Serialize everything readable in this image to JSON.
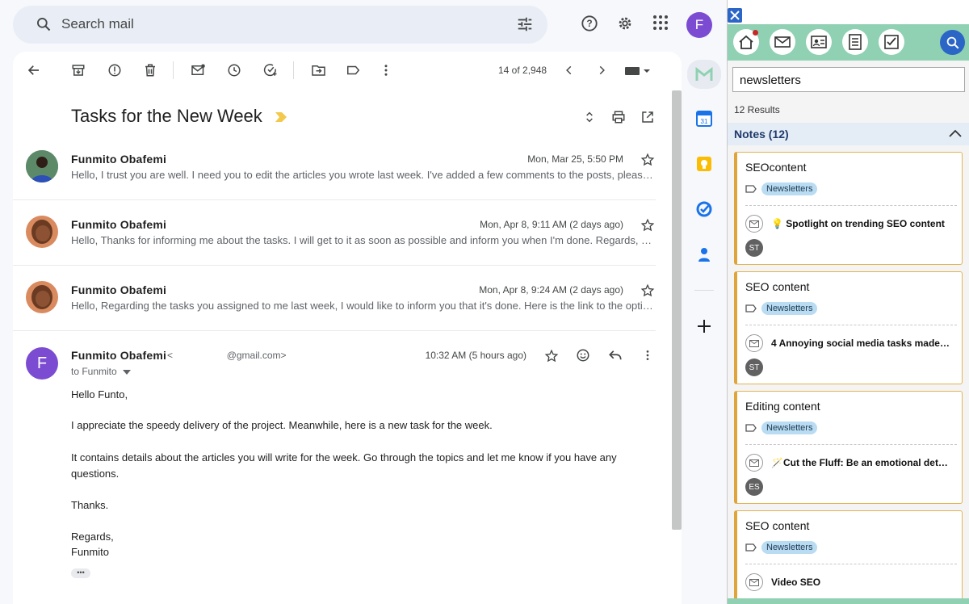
{
  "search": {
    "placeholder": "Search mail"
  },
  "account": {
    "initial": "F"
  },
  "toolbar": {
    "pager": "14 of 2,948"
  },
  "thread": {
    "subject": "Tasks for the New Week",
    "messages": [
      {
        "sender": "Funmito Obafemi",
        "date": "Mon, Mar 25, 5:50 PM",
        "snippet": "Hello, I trust you are well. I need you to edit the articles you wrote last week. I've added a few comments to the posts, please…"
      },
      {
        "sender": "Funmito Obafemi",
        "date": "Mon, Apr 8, 9:11 AM (2 days ago)",
        "snippet": "Hello, Thanks for informing me about the tasks. I will get to it as soon as possible and inform you when I'm done. Regards, …"
      },
      {
        "sender": "Funmito Obafemi",
        "date": "Mon, Apr 8, 9:24 AM (2 days ago)",
        "snippet": "Hello, Regarding the tasks you assigned to me last week, I would like to inform you that it's done. Here is the link to the opti…"
      }
    ],
    "open_message": {
      "sender": "Funmito Obafemi",
      "email": "<                    @gmail.com>",
      "date": "10:32 AM (5 hours ago)",
      "to": "to Funmito",
      "avatar_initial": "F",
      "body": [
        "Hello Funto,",
        "I appreciate the speedy delivery of the project. Meanwhile, here is a new task for the week.",
        "It contains details about the articles you will write for the week. Go through the topics and let me know if you have any",
        "questions.",
        "Thanks.",
        "Regards,",
        "Funmito"
      ],
      "more": "•••"
    }
  },
  "panel": {
    "search_value": "newsletters",
    "results": "12 Results",
    "notes_header": "Notes (12)",
    "notes": [
      {
        "title": "SEOcontent",
        "tag": "Newsletters",
        "mail": "💡 Spotlight on trending SEO content",
        "initials": "ST"
      },
      {
        "title": "SEO content",
        "tag": "Newsletters",
        "mail": "4 Annoying social media tasks made…",
        "initials": "ST"
      },
      {
        "title": "Editing content",
        "tag": "Newsletters",
        "mail": "🪄Cut the Fluff: Be an emotional det…",
        "initials": "ES"
      },
      {
        "title": "SEO content",
        "tag": "Newsletters",
        "mail": "Video SEO",
        "initials": ""
      }
    ]
  },
  "colors": {
    "accent": "#7b4bd1",
    "panel_nav": "#8fd1b2",
    "note_border": "#e0a43c",
    "tag_bg": "#b9dcf2"
  }
}
